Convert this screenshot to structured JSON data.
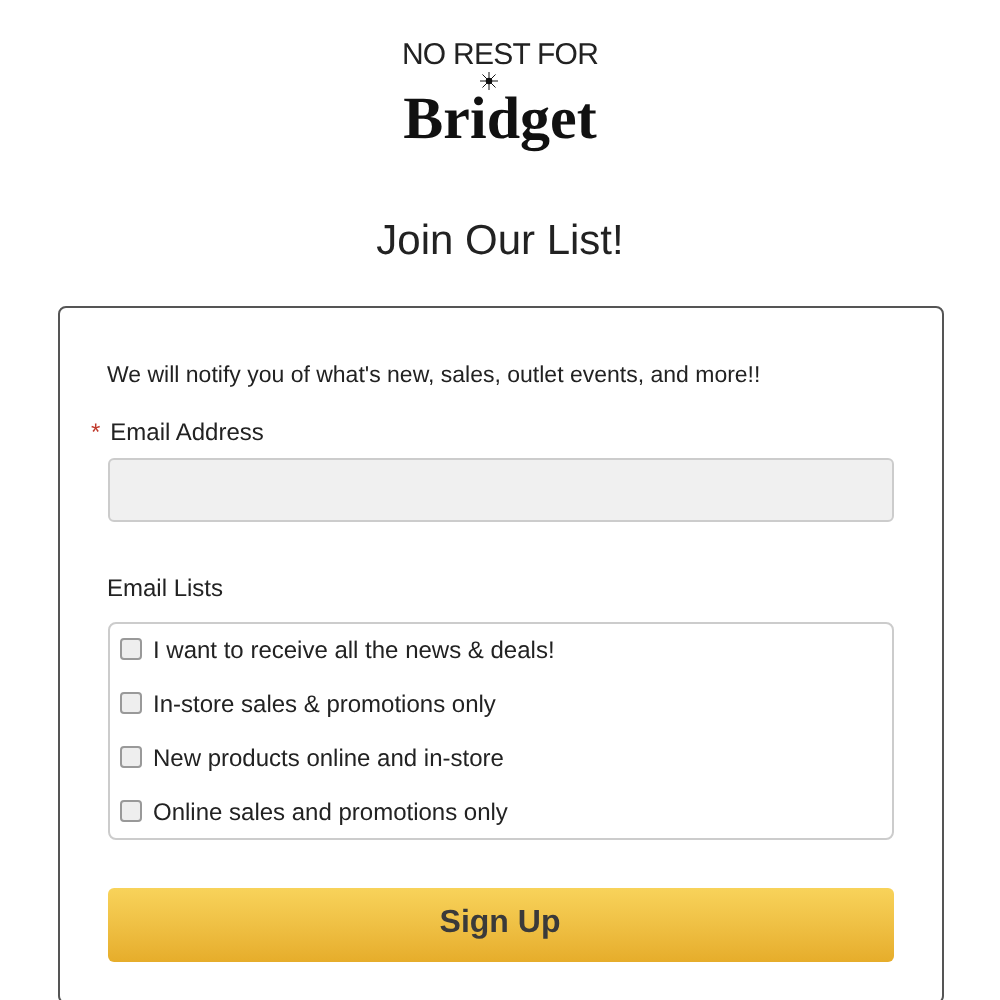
{
  "logo": {
    "line_1": "NO REST FOR",
    "line_2": "Bridget"
  },
  "title": "Join Our List!",
  "form": {
    "intro": "We will notify you of what's new, sales, outlet events, and more!!",
    "email": {
      "required_mark": "*",
      "label": "Email Address"
    },
    "lists": {
      "label": "Email Lists",
      "options": [
        {
          "label": "I want to receive all the news & deals!",
          "checked": false
        },
        {
          "label": "In-store sales & promotions only",
          "checked": false
        },
        {
          "label": "New products online and in-store",
          "checked": false
        },
        {
          "label": "Online sales and promotions only",
          "checked": false
        }
      ]
    },
    "submit": "Sign Up"
  }
}
